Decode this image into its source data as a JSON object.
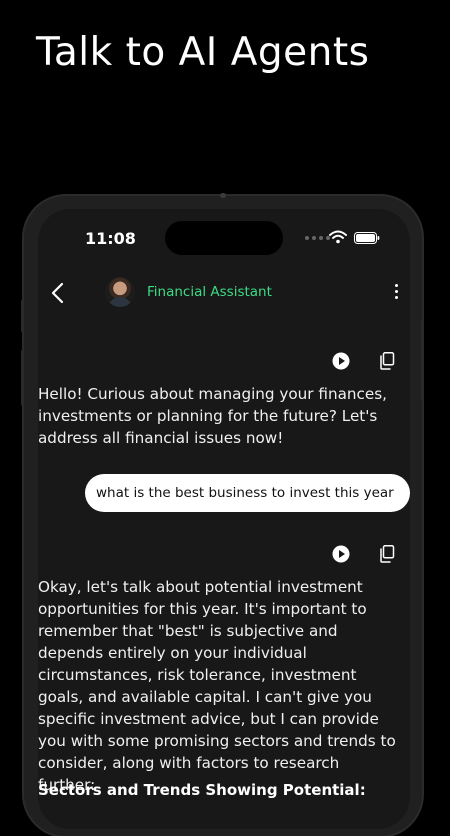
{
  "headline": "Talk to AI Agents",
  "status_bar": {
    "time": "11:08"
  },
  "chat_header": {
    "agent_name": "Financial Assistant"
  },
  "messages": [
    {
      "role": "assistant",
      "text": "Hello! Curious about managing your finances, investments or planning for the future? Let's address all financial issues now!"
    },
    {
      "role": "user",
      "text": "what is the best business to invest this year"
    },
    {
      "role": "assistant",
      "text": "Okay, let's talk about potential investment opportunities for this year.  It's important to remember that \"best\" is subjective and depends entirely on your individual circumstances, risk tolerance, investment goals, and available capital. I can't give you specific investment advice, but I can provide you with some promising sectors and trends to consider, along with factors to research further:",
      "section_title": "Sectors and Trends Showing Potential:"
    }
  ],
  "icons": {
    "play": "play-icon",
    "copy": "copy-icon",
    "back": "back-arrow-icon",
    "menu": "more-vertical-icon"
  },
  "colors": {
    "agent_name": "#3ddc84",
    "background": "#000000",
    "screen": "#181818",
    "user_bubble": "#ffffff"
  }
}
